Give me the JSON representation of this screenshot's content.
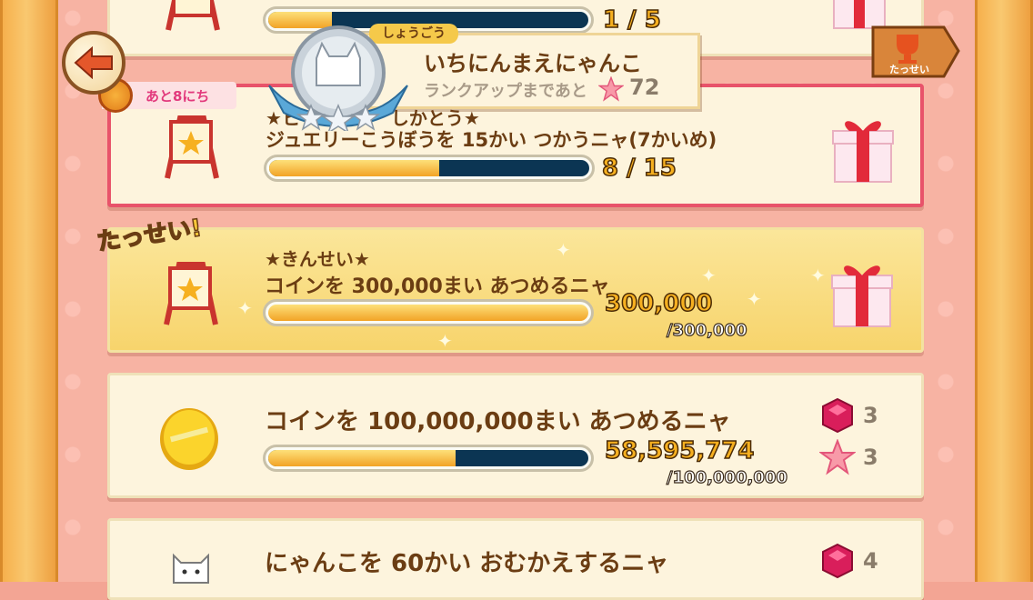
{
  "header": {
    "rank_tag": "しょうごう",
    "rank_name": "いちにんまえにゃんこ",
    "rank_up_text": "ランクアップまであと",
    "rank_up_value": "72",
    "trophy_label": "たっせい",
    "days_left": "あと8にち"
  },
  "missions": [
    {
      "id": "top-cut",
      "count": "1 / 5",
      "progress": 0.2
    },
    {
      "id": "jewelry",
      "title": "★ヒ　　　　　しかとう★",
      "desc": "ジュエリーこうぼうを 15かい つかうニャ(7かいめ)",
      "count": "8 / 15",
      "progress": 0.533
    },
    {
      "id": "coin-300k",
      "title": "★きんせい★",
      "desc": "コインを 300,000まい あつめるニャ",
      "count": "300,000",
      "total": "/300,000",
      "progress": 1.0,
      "stamp": "たっせい!"
    },
    {
      "id": "coin-100m",
      "desc": "コインを 100,000,000まい あつめるニャ",
      "count": "58,595,774",
      "total": "/100,000,000",
      "progress": 0.586,
      "rewards": [
        {
          "type": "gem-icon",
          "amount": "3"
        },
        {
          "type": "star-icon",
          "amount": "3"
        }
      ]
    },
    {
      "id": "cat-60",
      "desc": "にゃんこを 60かい おむかえするニャ",
      "rewards": [
        {
          "type": "gem-icon",
          "amount": "4"
        }
      ]
    }
  ],
  "colors": {
    "accent_pink": "#e8536a",
    "bar_track": "#0b3553",
    "bar_fill": "#f2a326",
    "text_brown": "#6b3d13"
  }
}
